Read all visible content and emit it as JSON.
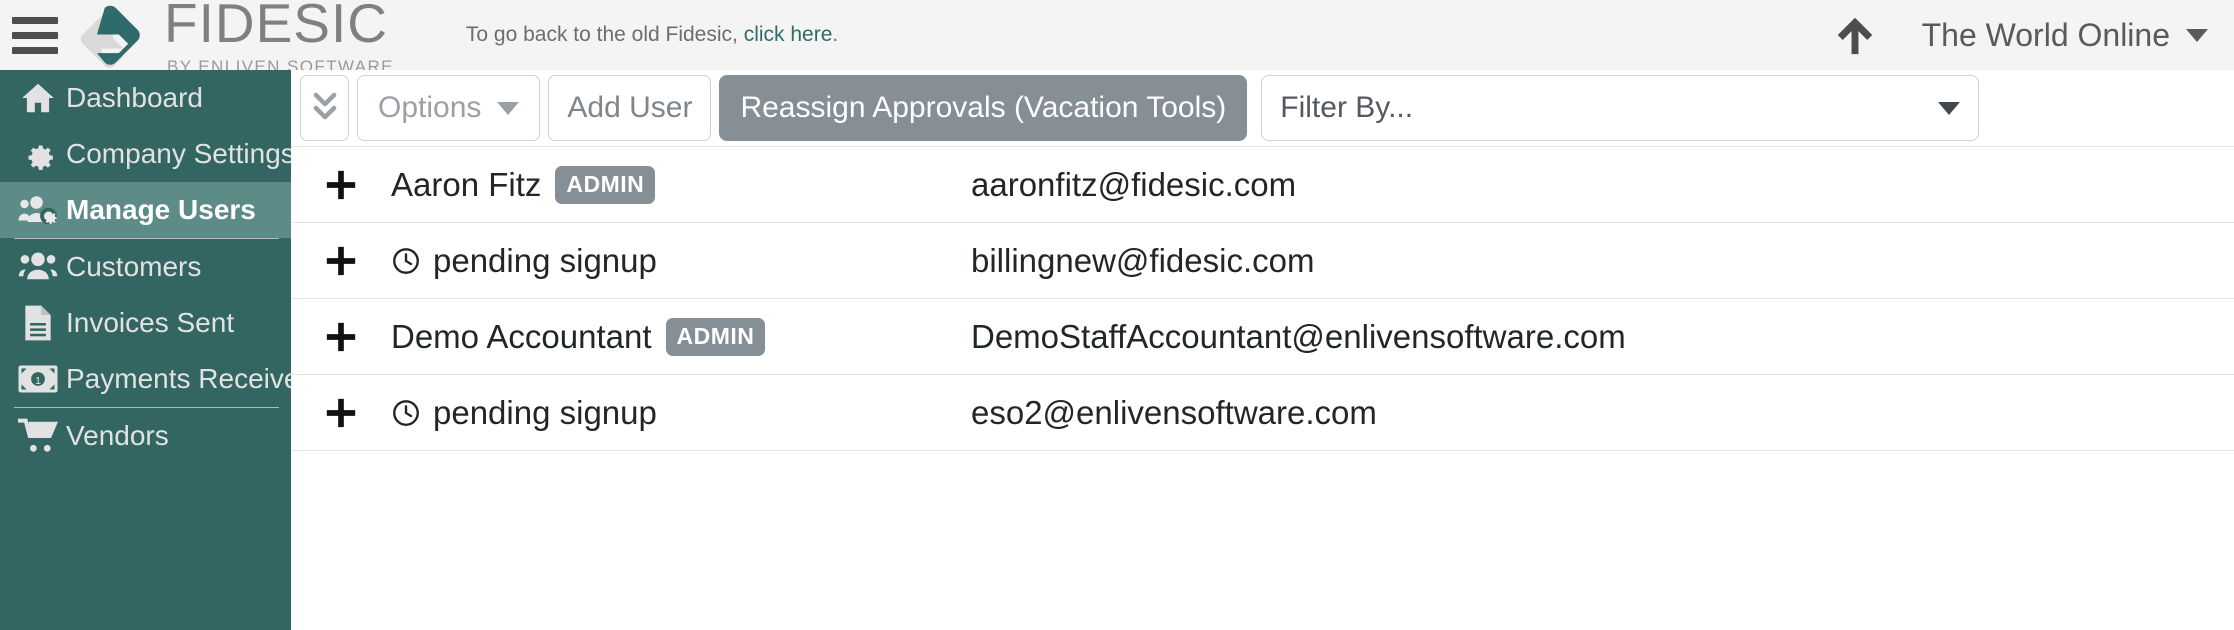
{
  "topbar": {
    "menu_icon": "hamburger-icon",
    "brand_title": "FIDESIC",
    "brand_subtitle": "BY ENLIVEN SOFTWARE",
    "legacy_notice_prefix": "To go back to the old Fidesic, ",
    "legacy_notice_link": "click here",
    "legacy_notice_suffix": ".",
    "upload_icon": "up-arrow-icon",
    "account_name": "The World Online",
    "account_caret": "chevron-down-icon"
  },
  "sidebar": {
    "items": [
      {
        "label": "Dashboard",
        "icon": "home-icon",
        "active": false
      },
      {
        "label": "Company Settings",
        "icon": "gear-icon",
        "active": false
      },
      {
        "label": "Manage Users",
        "icon": "users-gear-icon",
        "active": true
      },
      {
        "label": "Customers",
        "icon": "users-icon",
        "active": false
      },
      {
        "label": "Invoices Sent",
        "icon": "document-icon",
        "active": false
      },
      {
        "label": "Payments Received",
        "icon": "money-bill-icon",
        "active": false
      },
      {
        "label": "Vendors",
        "icon": "cart-icon",
        "active": false
      }
    ]
  },
  "toolbar": {
    "collapse_label": "double-chevron-down-icon",
    "options_label": "Options",
    "add_user_label": "Add User",
    "reassign_label": "Reassign Approvals (Vacation Tools)",
    "filter_label": "Filter By..."
  },
  "users": [
    {
      "expand": "+",
      "name": "Aaron Fitz",
      "pending": false,
      "badge": "ADMIN",
      "email": "aaronfitz@fidesic.com"
    },
    {
      "expand": "+",
      "name": "pending signup",
      "pending": true,
      "badge": "",
      "email": "billingnew@fidesic.com"
    },
    {
      "expand": "+",
      "name": "Demo Accountant",
      "pending": false,
      "badge": "ADMIN",
      "email": "DemoStaffAccountant@enlivensoftware.com"
    },
    {
      "expand": "+",
      "name": "pending signup",
      "pending": true,
      "badge": "",
      "email": "eso2@enlivensoftware.com"
    }
  ],
  "colors": {
    "sidebar_bg": "#336662",
    "sidebar_active": "#5d8b88",
    "brand_teal": "#2f6b6b",
    "button_gray": "#868e96",
    "topbar_bg": "#f4f4f4"
  }
}
